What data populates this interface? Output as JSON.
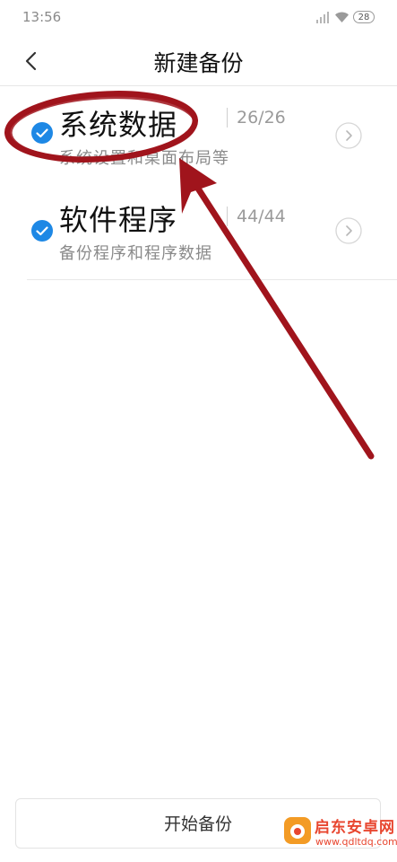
{
  "status_bar": {
    "time": "13:56",
    "battery": "28",
    "signal_icon": "signal-bars-icon",
    "wifi_icon": "wifi-icon"
  },
  "header": {
    "title": "新建备份",
    "back_icon": "chevron-left-icon"
  },
  "items": [
    {
      "title": "系统数据",
      "subtitle": "系统设置和桌面布局等",
      "count": "26/26",
      "checked": true
    },
    {
      "title": "软件程序",
      "subtitle": "备份程序和程序数据",
      "count": "44/44",
      "checked": true
    }
  ],
  "footer": {
    "start_button_label": "开始备份"
  },
  "watermark": {
    "title": "启东安卓网",
    "url": "www.qdltdq.com"
  },
  "colors": {
    "check_blue": "#1E88E5",
    "annotation_red": "#A0141C",
    "watermark_red": "#E8462F"
  }
}
